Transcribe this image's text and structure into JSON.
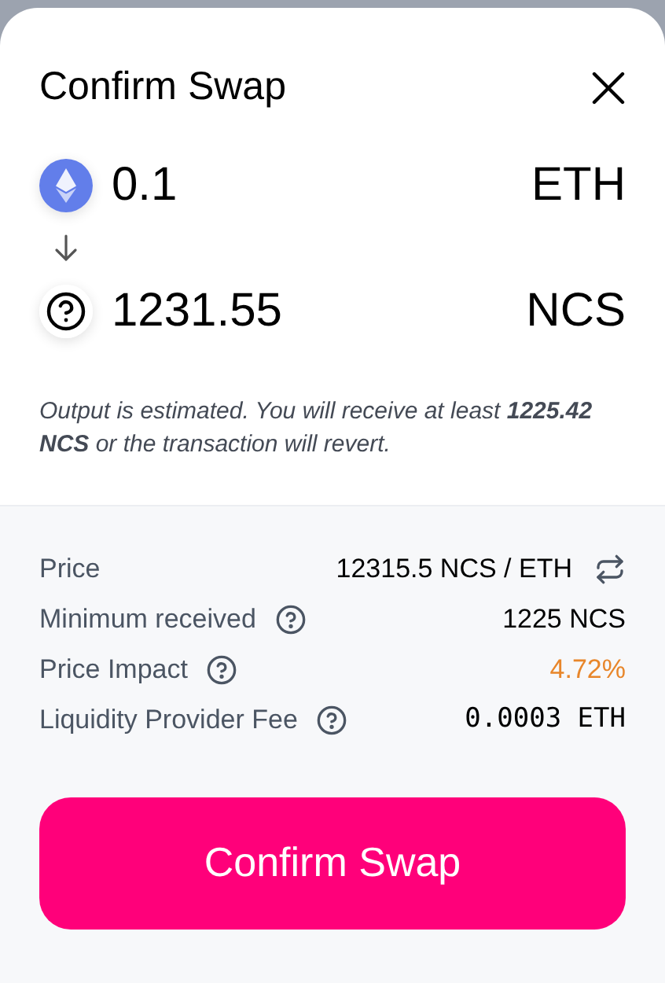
{
  "title": "Confirm Swap",
  "input": {
    "amount": "0.1",
    "symbol": "ETH",
    "kind": "eth"
  },
  "output": {
    "amount": "1231.55",
    "symbol": "NCS",
    "kind": "unknown"
  },
  "note": "Output is estimated. You will receive at least **1225.42 NCS** or the transaction will revert.",
  "details": [
    {
      "label": "Price",
      "value": "12315.5 NCS / ETH",
      "help": false,
      "swap_toggle": true,
      "warning": false,
      "mono": false
    },
    {
      "label": "Minimum received",
      "value": "1225 NCS",
      "help": true,
      "swap_toggle": false,
      "warning": false,
      "mono": false
    },
    {
      "label": "Price Impact",
      "value": "4.72%",
      "help": true,
      "swap_toggle": false,
      "warning": true,
      "mono": false
    },
    {
      "label": "Liquidity Provider Fee",
      "value": "0.0003 ETH",
      "help": true,
      "swap_toggle": false,
      "warning": false,
      "mono": true
    }
  ],
  "confirm_button": "Confirm Swap"
}
